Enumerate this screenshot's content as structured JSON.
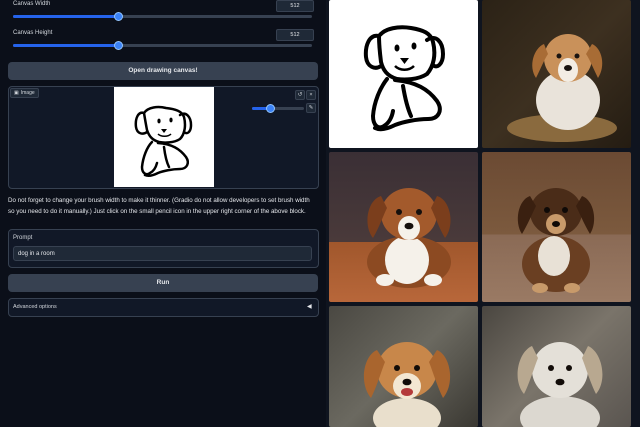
{
  "controls": {
    "canvas_width": {
      "label": "Canvas Width",
      "value": "512",
      "fraction": 0.35
    },
    "canvas_height": {
      "label": "Canvas Height",
      "value": "512",
      "fraction": 0.35
    }
  },
  "open_canvas_button": "Open drawing canvas!",
  "image_block": {
    "tag": "Image",
    "brush_fraction": 0.35,
    "undo_icon": "undo-icon",
    "close_icon": "close-icon",
    "pencil_icon": "pencil-icon"
  },
  "note_lines": [
    "Do not forget to change your brush width to make it thinner. (Gradio do not allow developers to set brush width",
    "so you need to do it manually.) Just click on the small pencil icon in the upper right corner of the above block."
  ],
  "prompt": {
    "label": "Prompt",
    "value": "dog in a room"
  },
  "run_button": "Run",
  "advanced": {
    "label": "Advanced options",
    "icon": "triangle-left-icon"
  },
  "colors": {
    "accent": "#2563eb",
    "panel": "#111827",
    "button": "#374151"
  }
}
